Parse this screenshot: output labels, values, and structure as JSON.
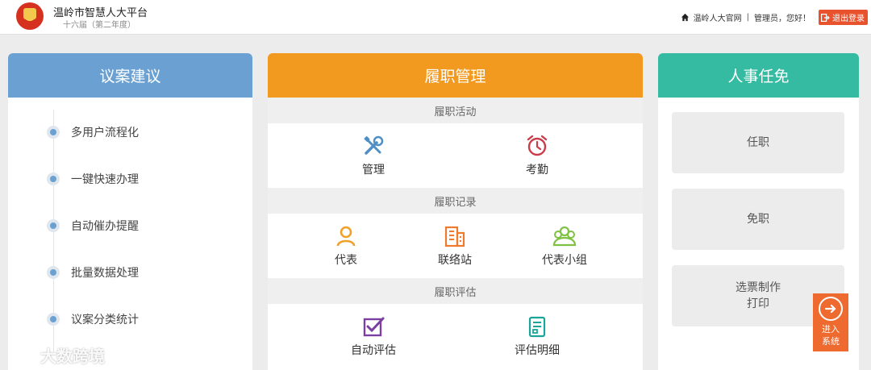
{
  "header": {
    "title": "温岭市智慧人大平台",
    "subtitle": "十六届（第二年度）",
    "home_link": "温岭人大官网",
    "separator": "|",
    "greeting": "管理员，您好！",
    "logout": "退出登录"
  },
  "panels": {
    "proposal": {
      "title": "议案建议",
      "items": [
        "多用户流程化",
        "一键快速办理",
        "自动催办提醒",
        "批量数据处理",
        "议案分类统计"
      ]
    },
    "duty": {
      "title": "履职管理",
      "sections": [
        {
          "label": "履职活动",
          "items": [
            {
              "label": "管理",
              "icon": "tools-icon"
            },
            {
              "label": "考勤",
              "icon": "alarm-clock-icon"
            }
          ]
        },
        {
          "label": "履职记录",
          "items": [
            {
              "label": "代表",
              "icon": "person-icon"
            },
            {
              "label": "联络站",
              "icon": "building-icon"
            },
            {
              "label": "代表小组",
              "icon": "group-icon"
            }
          ]
        },
        {
          "label": "履职评估",
          "items": [
            {
              "label": "自动评估",
              "icon": "checklist-icon"
            },
            {
              "label": "评估明细",
              "icon": "report-icon"
            }
          ]
        }
      ]
    },
    "personnel": {
      "title": "人事任免",
      "buttons": [
        "任职",
        "免职"
      ],
      "ballot": {
        "line1": "选票制作",
        "line2": "打印"
      }
    }
  },
  "enter_system": {
    "line1": "进入",
    "line2": "系统"
  },
  "watermark": "大数跨境",
  "colors": {
    "blue": "#6ba1d2",
    "orange": "#f29a1f",
    "teal": "#36bba3",
    "accent": "#ef6a2e",
    "tools": "#4f8fc6",
    "alarm": "#c93c4a",
    "person": "#f0a12a",
    "building": "#f07a2b",
    "group": "#7fc243",
    "checklist": "#7b3fa2",
    "report": "#1aa59a"
  }
}
